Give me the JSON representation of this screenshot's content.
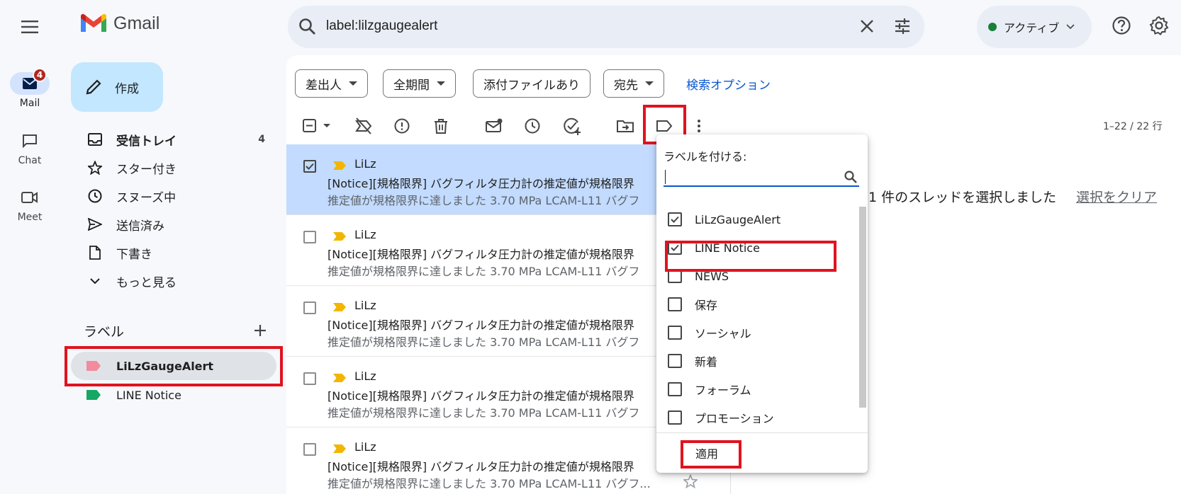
{
  "app": {
    "name": "Gmail"
  },
  "rail": {
    "items": [
      {
        "label": "Mail",
        "badge": "4"
      },
      {
        "label": "Chat"
      },
      {
        "label": "Meet"
      }
    ]
  },
  "search": {
    "query": "label:lilzgaugealert"
  },
  "status": {
    "label": "アクティブ",
    "color": "#188038"
  },
  "sidebar": {
    "compose_label": "作成",
    "nav": [
      {
        "label": "受信トレイ",
        "count": "4",
        "icon": "inbox-icon"
      },
      {
        "label": "スター付き",
        "icon": "star-icon"
      },
      {
        "label": "スヌーズ中",
        "icon": "clock-icon"
      },
      {
        "label": "送信済み",
        "icon": "send-icon"
      },
      {
        "label": "下書き",
        "icon": "draft-icon"
      },
      {
        "label": "もっと見る",
        "icon": "chevron-down-icon"
      }
    ],
    "labels_header": "ラベル",
    "labels": [
      {
        "label": "LiLzGaugeAlert",
        "color": "#f28b9e",
        "selected": true
      },
      {
        "label": "LINE Notice",
        "color": "#16a765"
      }
    ]
  },
  "filters": {
    "chips": [
      "差出人",
      "全期間",
      "添付ファイルあり",
      "宛先"
    ],
    "advanced_link": "検索オプション"
  },
  "toolbar": {
    "count_text": "1–22 / 22 行"
  },
  "mail_rows": [
    {
      "from": "LiLz",
      "subject": "[Notice][規格限界] バグフィルタ圧力計の推定値が規格限界",
      "snippet": "推定値が規格限界に達しました 3.70 MPa LCAM-L11 バグフ",
      "selected": true
    },
    {
      "from": "LiLz",
      "subject": "[Notice][規格限界] バグフィルタ圧力計の推定値が規格限界",
      "snippet": "推定値が規格限界に達しました 3.70 MPa LCAM-L11 バグフ",
      "selected": false
    },
    {
      "from": "LiLz",
      "subject": "[Notice][規格限界] バグフィルタ圧力計の推定値が規格限界",
      "snippet": "推定値が規格限界に達しました 3.70 MPa LCAM-L11 バグフ",
      "selected": false
    },
    {
      "from": "LiLz",
      "subject": "[Notice][規格限界] バグフィルタ圧力計の推定値が規格限界",
      "snippet": "推定値が規格限界に達しました 3.70 MPa LCAM-L11 バグフ",
      "selected": false
    },
    {
      "from": "LiLz",
      "subject": "[Notice][規格限界] バグフィルタ圧力計の推定値が規格限界",
      "snippet": "推定値が規格限界に達しました 3.70 MPa LCAM-L11 バグフ...",
      "selected": false
    }
  ],
  "selection": {
    "message": "1 件のスレッドを選択しました",
    "clear_link": "選択をクリア"
  },
  "label_popup": {
    "title": "ラベルを付ける:",
    "items": [
      {
        "label": "LiLzGaugeAlert",
        "checked": true
      },
      {
        "label": "LINE Notice",
        "checked": true
      },
      {
        "label": "NEWS",
        "checked": false
      },
      {
        "label": "保存",
        "checked": false
      },
      {
        "label": "ソーシャル",
        "checked": false
      },
      {
        "label": "新着",
        "checked": false
      },
      {
        "label": "フォーラム",
        "checked": false
      },
      {
        "label": "プロモーション",
        "checked": false
      }
    ],
    "apply_label": "適用"
  },
  "highlight_color": "#e0131f"
}
